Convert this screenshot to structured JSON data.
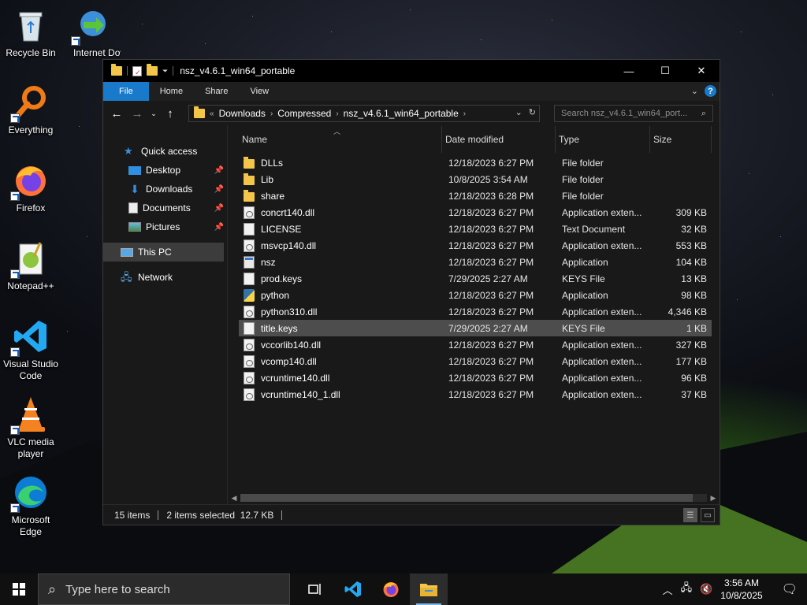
{
  "desktop": {
    "icons": [
      {
        "label": "Recycle Bin",
        "icon": "recycle-bin-icon"
      },
      {
        "label": "Internet Downlo",
        "icon": "internet-download-manager-icon"
      },
      {
        "label": "Everything",
        "icon": "everything-search-icon"
      },
      {
        "label": "Firefox",
        "icon": "firefox-icon"
      },
      {
        "label": "Notepad++",
        "icon": "notepadpp-icon"
      },
      {
        "label": "Visual Studio Code",
        "icon": "vscode-icon"
      },
      {
        "label": "VLC media player",
        "icon": "vlc-icon"
      },
      {
        "label": "Microsoft Edge",
        "icon": "edge-icon"
      }
    ]
  },
  "window": {
    "title": "nsz_v4.6.1_win64_portable",
    "controls": {
      "minimize": "—",
      "maximize": "☐",
      "close": "✕"
    },
    "ribbon": {
      "tabs": [
        "File",
        "Home",
        "Share",
        "View"
      ]
    },
    "address": {
      "prefix": "«",
      "crumbs": [
        "Downloads",
        "Compressed",
        "nsz_v4.6.1_win64_portable"
      ]
    },
    "search_placeholder": "Search nsz_v4.6.1_win64_port...",
    "nav_pane": {
      "quick_access": "Quick access",
      "items": [
        "Desktop",
        "Downloads",
        "Documents",
        "Pictures"
      ],
      "this_pc": "This PC",
      "network": "Network"
    },
    "columns": {
      "name": "Name",
      "date": "Date modified",
      "type": "Type",
      "size": "Size"
    },
    "files": [
      {
        "name": "DLLs",
        "date": "12/18/2023 6:27 PM",
        "type": "File folder",
        "size": "",
        "icon": "folder"
      },
      {
        "name": "Lib",
        "date": "10/8/2025 3:54 AM",
        "type": "File folder",
        "size": "",
        "icon": "folder"
      },
      {
        "name": "share",
        "date": "12/18/2023 6:28 PM",
        "type": "File folder",
        "size": "",
        "icon": "folder"
      },
      {
        "name": "concrt140.dll",
        "date": "12/18/2023 6:27 PM",
        "type": "Application exten...",
        "size": "309 KB",
        "icon": "dll"
      },
      {
        "name": "LICENSE",
        "date": "12/18/2023 6:27 PM",
        "type": "Text Document",
        "size": "32 KB",
        "icon": "doc"
      },
      {
        "name": "msvcp140.dll",
        "date": "12/18/2023 6:27 PM",
        "type": "Application exten...",
        "size": "553 KB",
        "icon": "dll"
      },
      {
        "name": "nsz",
        "date": "12/18/2023 6:27 PM",
        "type": "Application",
        "size": "104 KB",
        "icon": "app"
      },
      {
        "name": "prod.keys",
        "date": "7/29/2025 2:27 AM",
        "type": "KEYS File",
        "size": "13 KB",
        "icon": "doc"
      },
      {
        "name": "python",
        "date": "12/18/2023 6:27 PM",
        "type": "Application",
        "size": "98 KB",
        "icon": "py"
      },
      {
        "name": "python310.dll",
        "date": "12/18/2023 6:27 PM",
        "type": "Application exten...",
        "size": "4,346 KB",
        "icon": "dll"
      },
      {
        "name": "title.keys",
        "date": "7/29/2025 2:27 AM",
        "type": "KEYS File",
        "size": "1 KB",
        "icon": "doc",
        "selected": true
      },
      {
        "name": "vccorlib140.dll",
        "date": "12/18/2023 6:27 PM",
        "type": "Application exten...",
        "size": "327 KB",
        "icon": "dll"
      },
      {
        "name": "vcomp140.dll",
        "date": "12/18/2023 6:27 PM",
        "type": "Application exten...",
        "size": "177 KB",
        "icon": "dll"
      },
      {
        "name": "vcruntime140.dll",
        "date": "12/18/2023 6:27 PM",
        "type": "Application exten...",
        "size": "96 KB",
        "icon": "dll"
      },
      {
        "name": "vcruntime140_1.dll",
        "date": "12/18/2023 6:27 PM",
        "type": "Application exten...",
        "size": "37 KB",
        "icon": "dll"
      }
    ],
    "status": {
      "items": "15 items",
      "selection": "2 items selected  12.7 KB"
    }
  },
  "taskbar": {
    "search_placeholder": "Type here to search",
    "apps": [
      "task-view-icon",
      "vscode-icon",
      "firefox-icon",
      "file-explorer-icon"
    ],
    "clock": {
      "time": "3:56 AM",
      "date": "10/8/2025"
    }
  },
  "colors": {
    "accent": "#1979ca",
    "selection": "#4d4d4d",
    "folder": "#f3c64a"
  }
}
